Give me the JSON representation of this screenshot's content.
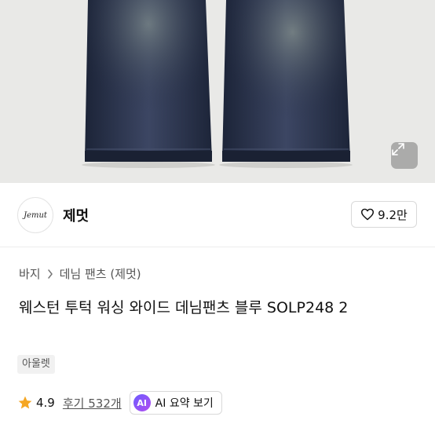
{
  "hero": {
    "image_alt": "denim pants product image",
    "expand_icon": "expand-icon"
  },
  "brand": {
    "logo_text": "Jemut",
    "name": "제멋",
    "like_icon": "heart-icon",
    "like_count": "9.2만"
  },
  "breadcrumb": {
    "items": [
      "바지",
      "데님 팬츠 (제멋)"
    ],
    "separator_icon": "chevron-right-icon"
  },
  "product": {
    "title": "웨스턴 투턱 워싱 와이드 데님팬츠 블루 SOLP248 2",
    "tag": "아울렛"
  },
  "rating": {
    "star_icon": "star-icon",
    "value": "4.9",
    "review_text": "후기 532개",
    "ai_badge": "AI",
    "ai_label": "AI 요약 보기"
  },
  "colors": {
    "star": "#f5a623",
    "ai_gradient_start": "#6d5cff",
    "ai_gradient_end": "#b24cf0"
  }
}
